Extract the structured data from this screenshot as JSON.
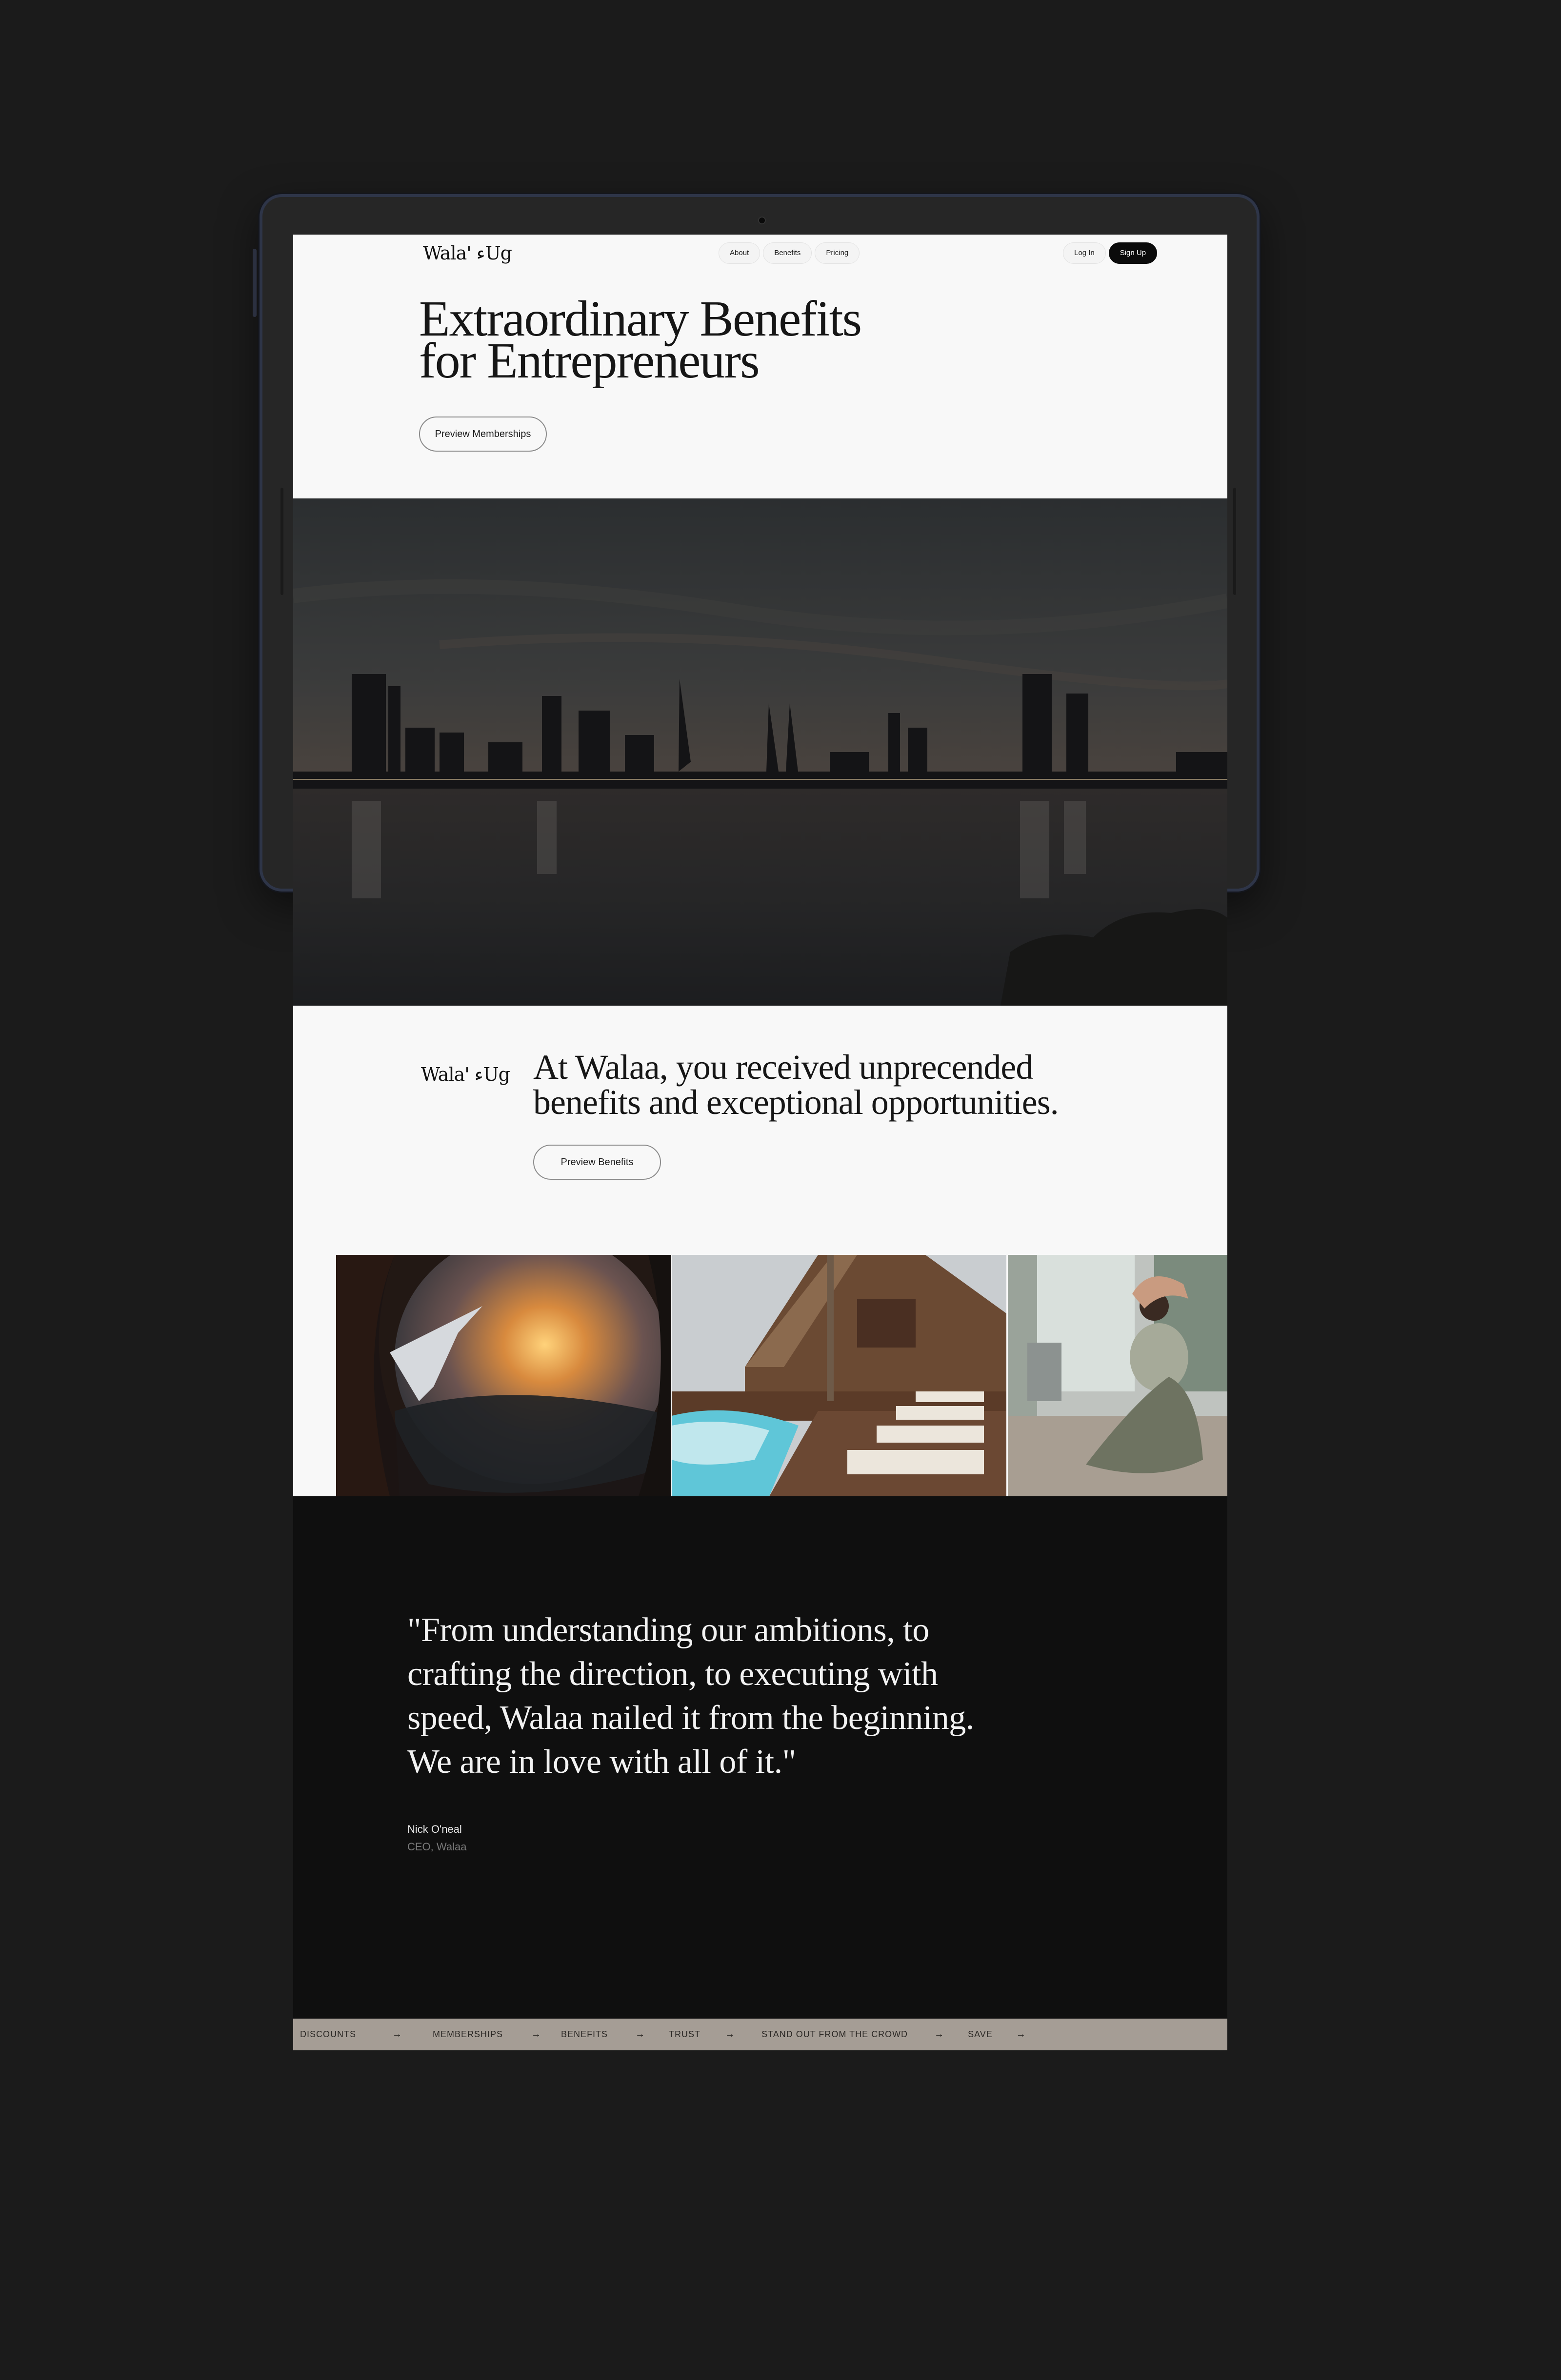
{
  "nav": {
    "logo": "Wala' ءUg",
    "links": [
      "About",
      "Benefits",
      "Pricing"
    ],
    "login": "Log In",
    "signup": "Sign Up"
  },
  "hero": {
    "title_line1": "Extraordinary Benefits",
    "title_line2": "for Entrepreneurs",
    "button": "Preview Memberships"
  },
  "about": {
    "logo": "Wala' ءUg",
    "text_line1": "At Walaa, you received unprecended",
    "text_line2": "benefits and exceptional opportunities.",
    "button": "Preview Benefits"
  },
  "testimonial": {
    "line1": "\"From understanding our ambitions, to",
    "line2": "crafting the direction, to executing with",
    "line3": "speed, Walaa nailed it from the beginning.",
    "line4": "We are in love with all of it.\"",
    "author": "Nick O'neal",
    "role": "CEO, Walaa"
  },
  "ticker": {
    "items": [
      "DISCOUNTS",
      "MEMBERSHIPS",
      "BENEFITS",
      "TRUST",
      "STAND OUT FROM THE CROWD",
      "SAVE"
    ],
    "arrow": "→"
  },
  "colors": {
    "background": "#1b1b1b",
    "page": "#f8f8f8",
    "dark_section": "#0f0f0f",
    "ticker": "#a59d95",
    "device_frame": "#2e3548"
  }
}
